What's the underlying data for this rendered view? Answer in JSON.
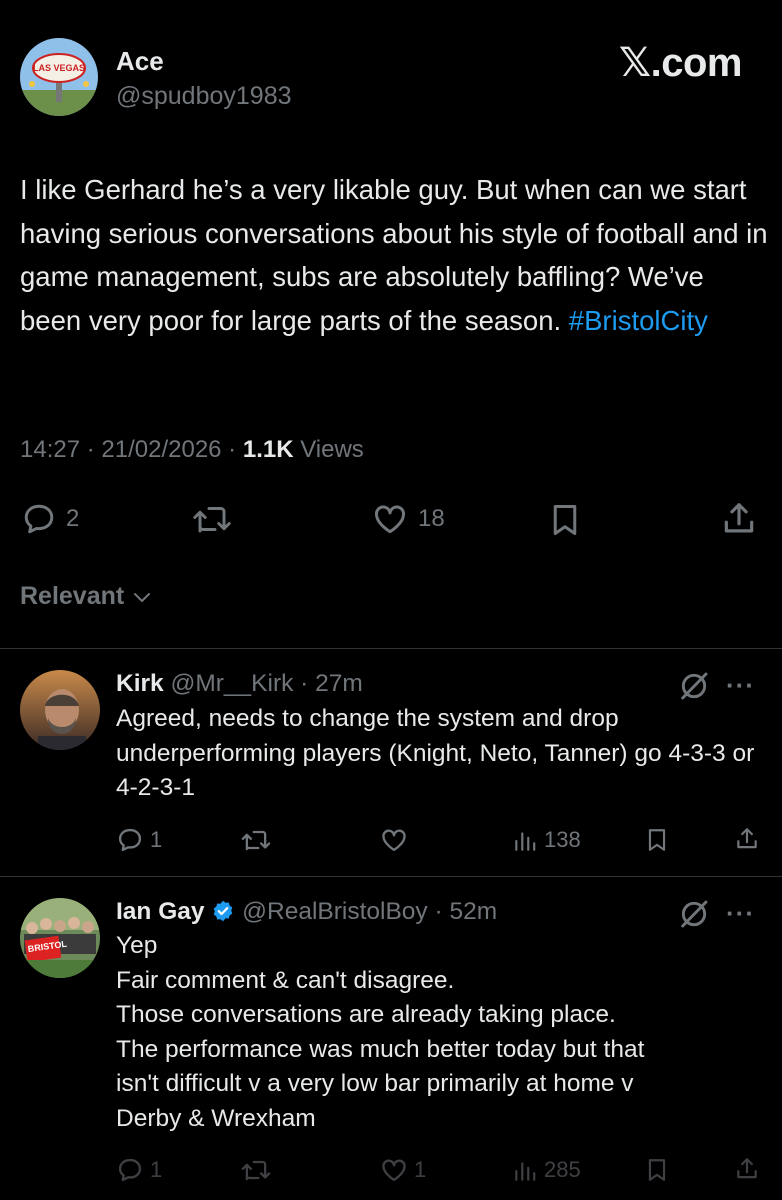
{
  "main_tweet": {
    "author_name": "Ace",
    "author_handle": "@spudboy1983",
    "site_logo_x": "𝕏",
    "site_logo_text": ".com",
    "text_before": "I like Gerhard he’s a very likable guy. But when can we start having serious conversations about his style of football and in game management, subs are absolutely baffling? We’ve been very poor for large parts of the season. ",
    "hashtag": "#BristolCity",
    "time": "14:27",
    "sep1": " · ",
    "date": "21/02/2026",
    "sep2": " · ",
    "views_count": "1.1K",
    "views_label": " Views",
    "replies": "2",
    "likes": "18"
  },
  "sort": {
    "label": "Relevant"
  },
  "replies": [
    {
      "name": "Kirk",
      "handle": "@Mr__Kirk",
      "time": " · 27m",
      "text": "Agreed, needs to change the system and drop underperforming players (Knight, Neto, Tanner) go 4-3-3 or 4-2-3-1",
      "reply_count": "1",
      "views": "138"
    },
    {
      "name": "Ian Gay",
      "handle": "@RealBristolBoy",
      "time": " · 52m",
      "lines": [
        "Yep",
        "Fair comment & can't disagree.",
        "Those conversations are already taking place.",
        "The performance was much better today but that",
        "isn't difficult v a very low bar primarily at home v",
        "Derby & Wrexham"
      ],
      "reply_count": "1",
      "like_count": "1",
      "views": "285"
    }
  ],
  "colors": {
    "background": "#000000",
    "text": "#e7e9ea",
    "muted": "#71767b",
    "link": "#1d9bf0",
    "verified": "#1d9bf0",
    "divider": "#2f3336"
  },
  "icons": [
    "reply-icon",
    "retweet-icon",
    "like-icon",
    "bookmark-icon",
    "share-icon",
    "views-icon",
    "grok-icon",
    "more-icon",
    "verified-badge-icon",
    "chevron-down-icon"
  ]
}
